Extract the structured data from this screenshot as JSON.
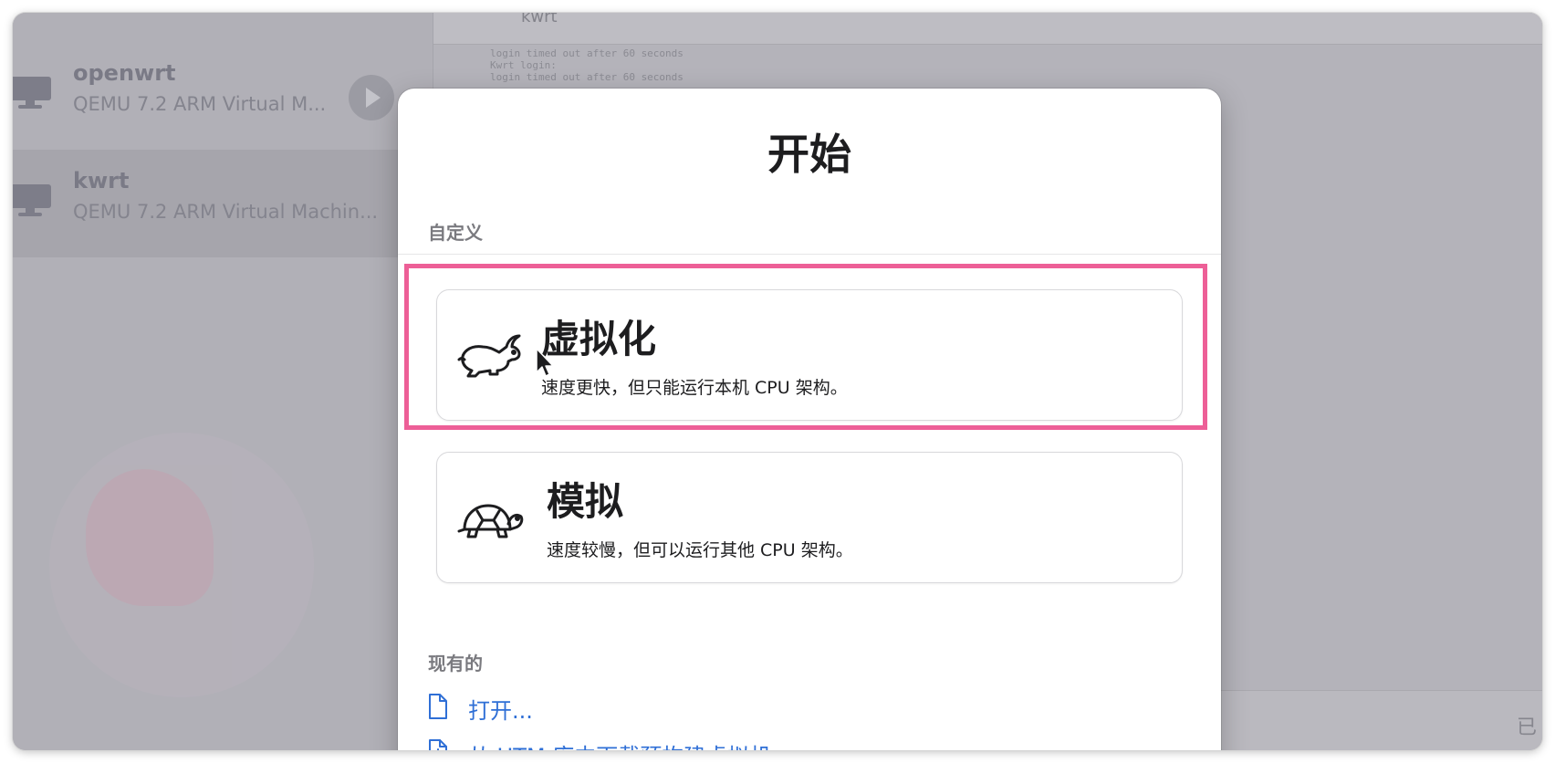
{
  "sidebar": {
    "vms": [
      {
        "name": "openwrt",
        "description": "QEMU 7.2 ARM Virtual M..."
      },
      {
        "name": "kwrt",
        "description": "QEMU 7.2 ARM Virtual Machin..."
      }
    ]
  },
  "console": {
    "header_title": "kwrt",
    "log_lines": [
      "login timed out after 60 seconds",
      "Kwrt login:",
      "login timed out after 60 seconds"
    ]
  },
  "bottom_bar": {
    "status_text": "已"
  },
  "dialog": {
    "title": "开始",
    "custom_section_label": "自定义",
    "options": [
      {
        "title": "虚拟化",
        "subtitle": "速度更快，但只能运行本机 CPU 架构。",
        "icon": "rabbit-icon"
      },
      {
        "title": "模拟",
        "subtitle": "速度较慢，但可以运行其他 CPU 架构。",
        "icon": "turtle-icon"
      }
    ],
    "existing_section_label": "现有的",
    "links": [
      {
        "label": "打开...",
        "icon": "document-icon"
      },
      {
        "label": "从 UTM 库中下载预构建虚拟机...",
        "icon": "download-document-icon"
      }
    ]
  },
  "colors": {
    "highlight": "#ed5f97",
    "link": "#2f6fd6",
    "overlay": "#b1b0b7"
  }
}
